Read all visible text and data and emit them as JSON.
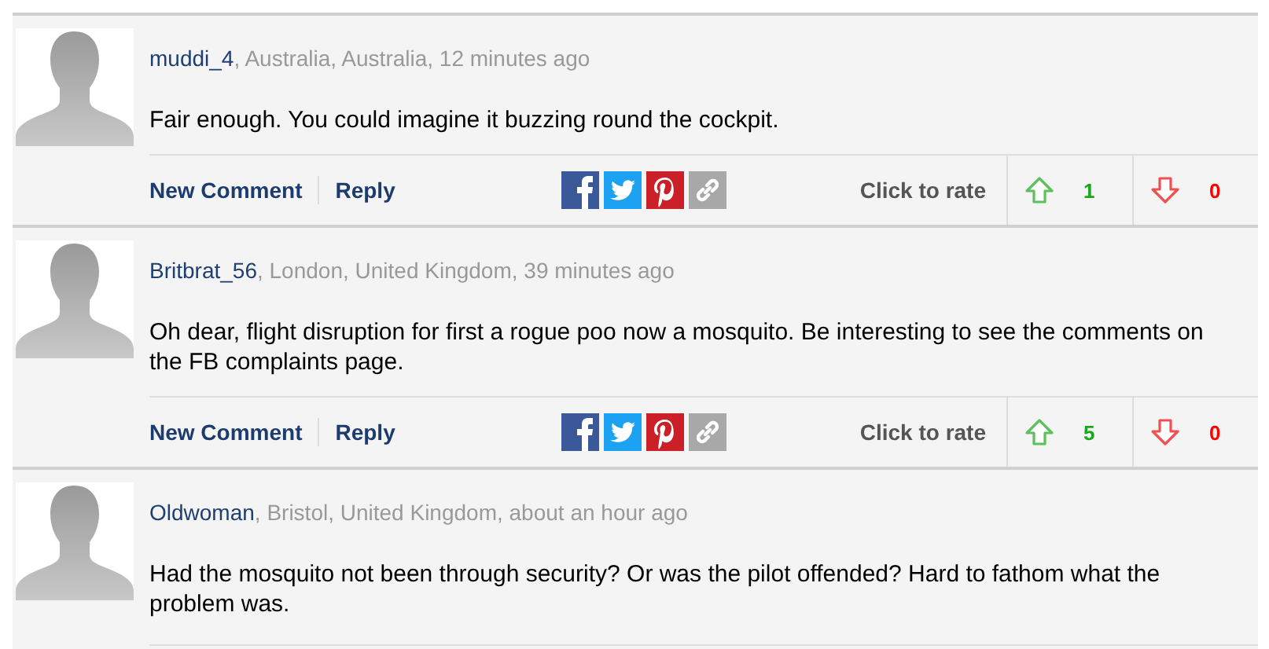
{
  "comments": [
    {
      "author": "muddi_4",
      "meta": ", Australia, Australia, 12 minutes ago",
      "text": "Fair enough. You could imagine it buzzing round the cockpit.",
      "footer": {
        "new_comment": "New Comment",
        "reply": "Reply",
        "rate_label": "Click to rate",
        "up_count": "1",
        "down_count": "0"
      }
    },
    {
      "author": "Britbrat_56",
      "meta": ", London, United Kingdom, 39 minutes ago",
      "text": "Oh dear, flight disruption for first a rogue poo now a mosquito. Be interesting to see the comments on the FB complaints page.",
      "footer": {
        "new_comment": "New Comment",
        "reply": "Reply",
        "rate_label": "Click to rate",
        "up_count": "5",
        "down_count": "0"
      }
    },
    {
      "author": "Oldwoman",
      "meta": ", Bristol, United Kingdom, about an hour ago",
      "text": "Had the mosquito not been through security? Or was the pilot offended? Hard to fathom what the problem was."
    }
  ]
}
